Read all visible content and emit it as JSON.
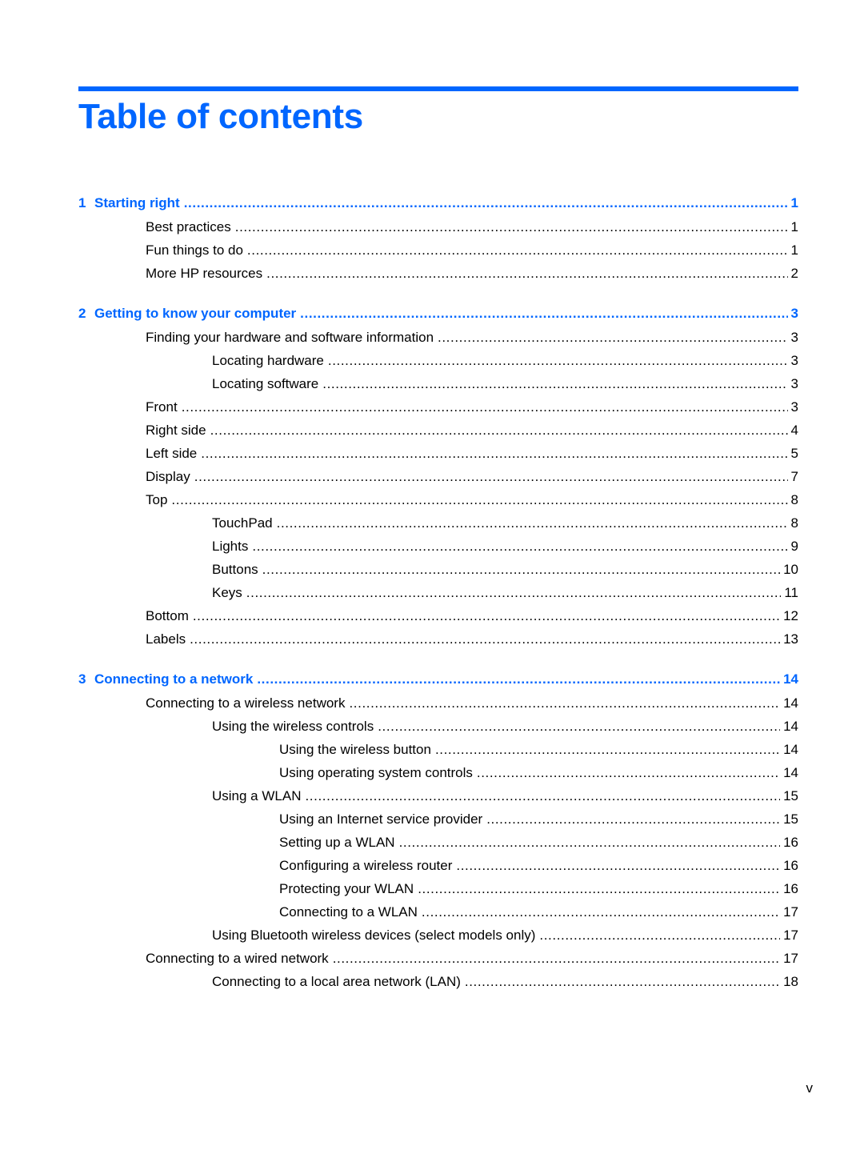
{
  "document": {
    "title": "Table of contents",
    "accent_color": "#0066ff",
    "page_label": "v"
  },
  "toc": {
    "chapters": [
      {
        "number": "1",
        "title": "Starting right",
        "page": "1",
        "entries": [
          {
            "level": 1,
            "title": "Best practices",
            "page": "1"
          },
          {
            "level": 1,
            "title": "Fun things to do",
            "page": "1"
          },
          {
            "level": 1,
            "title": "More HP resources",
            "page": "2"
          }
        ]
      },
      {
        "number": "2",
        "title": "Getting to know your computer",
        "page": "3",
        "entries": [
          {
            "level": 1,
            "title": "Finding your hardware and software information",
            "page": "3"
          },
          {
            "level": 2,
            "title": "Locating hardware",
            "page": "3"
          },
          {
            "level": 2,
            "title": "Locating software",
            "page": "3"
          },
          {
            "level": 1,
            "title": "Front",
            "page": "3"
          },
          {
            "level": 1,
            "title": "Right side",
            "page": "4"
          },
          {
            "level": 1,
            "title": "Left side",
            "page": "5"
          },
          {
            "level": 1,
            "title": "Display",
            "page": "7"
          },
          {
            "level": 1,
            "title": "Top",
            "page": "8"
          },
          {
            "level": 2,
            "title": "TouchPad",
            "page": "8"
          },
          {
            "level": 2,
            "title": "Lights",
            "page": "9"
          },
          {
            "level": 2,
            "title": "Buttons",
            "page": "10"
          },
          {
            "level": 2,
            "title": "Keys",
            "page": "11"
          },
          {
            "level": 1,
            "title": "Bottom",
            "page": "12"
          },
          {
            "level": 1,
            "title": "Labels",
            "page": "13"
          }
        ]
      },
      {
        "number": "3",
        "title": "Connecting to a network",
        "page": "14",
        "entries": [
          {
            "level": 1,
            "title": "Connecting to a wireless network",
            "page": "14"
          },
          {
            "level": 2,
            "title": "Using the wireless controls",
            "page": "14"
          },
          {
            "level": 3,
            "title": "Using the wireless button",
            "page": "14"
          },
          {
            "level": 3,
            "title": "Using operating system controls",
            "page": "14"
          },
          {
            "level": 2,
            "title": "Using a WLAN",
            "page": "15"
          },
          {
            "level": 3,
            "title": "Using an Internet service provider",
            "page": "15"
          },
          {
            "level": 3,
            "title": "Setting up a WLAN",
            "page": "16"
          },
          {
            "level": 3,
            "title": "Configuring a wireless router",
            "page": "16"
          },
          {
            "level": 3,
            "title": "Protecting your WLAN",
            "page": "16"
          },
          {
            "level": 3,
            "title": "Connecting to a WLAN",
            "page": "17"
          },
          {
            "level": 2,
            "title": "Using Bluetooth wireless devices (select models only)",
            "page": "17"
          },
          {
            "level": 1,
            "title": "Connecting to a wired network",
            "page": "17"
          },
          {
            "level": 2,
            "title": "Connecting to a local area network (LAN)",
            "page": "18"
          }
        ]
      }
    ]
  }
}
